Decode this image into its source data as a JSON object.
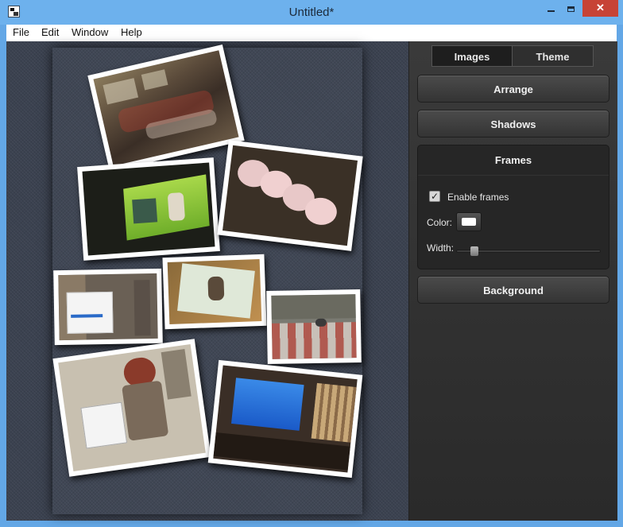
{
  "window": {
    "title": "Untitled*",
    "close_glyph": "✕"
  },
  "menubar": {
    "items": [
      "File",
      "Edit",
      "Window",
      "Help"
    ]
  },
  "panel": {
    "tabs": [
      {
        "label": "Images",
        "active": false
      },
      {
        "label": "Theme",
        "active": true
      }
    ],
    "sections": {
      "arrange": "Arrange",
      "shadows": "Shadows",
      "frames": "Frames",
      "background": "Background"
    },
    "frames": {
      "enable_label": "Enable frames",
      "enable_checked": true,
      "check_glyph": "✓",
      "color_label": "Color:",
      "color_value": "#ffffff",
      "width_label": "Width:",
      "width_value_fraction": 0.1
    }
  },
  "collage": {
    "photos": [
      {
        "name": "party-photo",
        "icon": "photo"
      },
      {
        "name": "presentation-screen-photo",
        "icon": "photo"
      },
      {
        "name": "fans-photo",
        "icon": "photo"
      },
      {
        "name": "seminar-sign-photo",
        "icon": "photo"
      },
      {
        "name": "illustration-card-photo",
        "icon": "photo"
      },
      {
        "name": "pavement-photo",
        "icon": "photo"
      },
      {
        "name": "character-standee-photo",
        "icon": "photo"
      },
      {
        "name": "lecture-hall-photo",
        "icon": "photo"
      }
    ]
  },
  "colors": {
    "titlebar": "#6db1ed",
    "close": "#c74336",
    "panel": "#2f2f2f",
    "canvas": "#3b4250"
  }
}
